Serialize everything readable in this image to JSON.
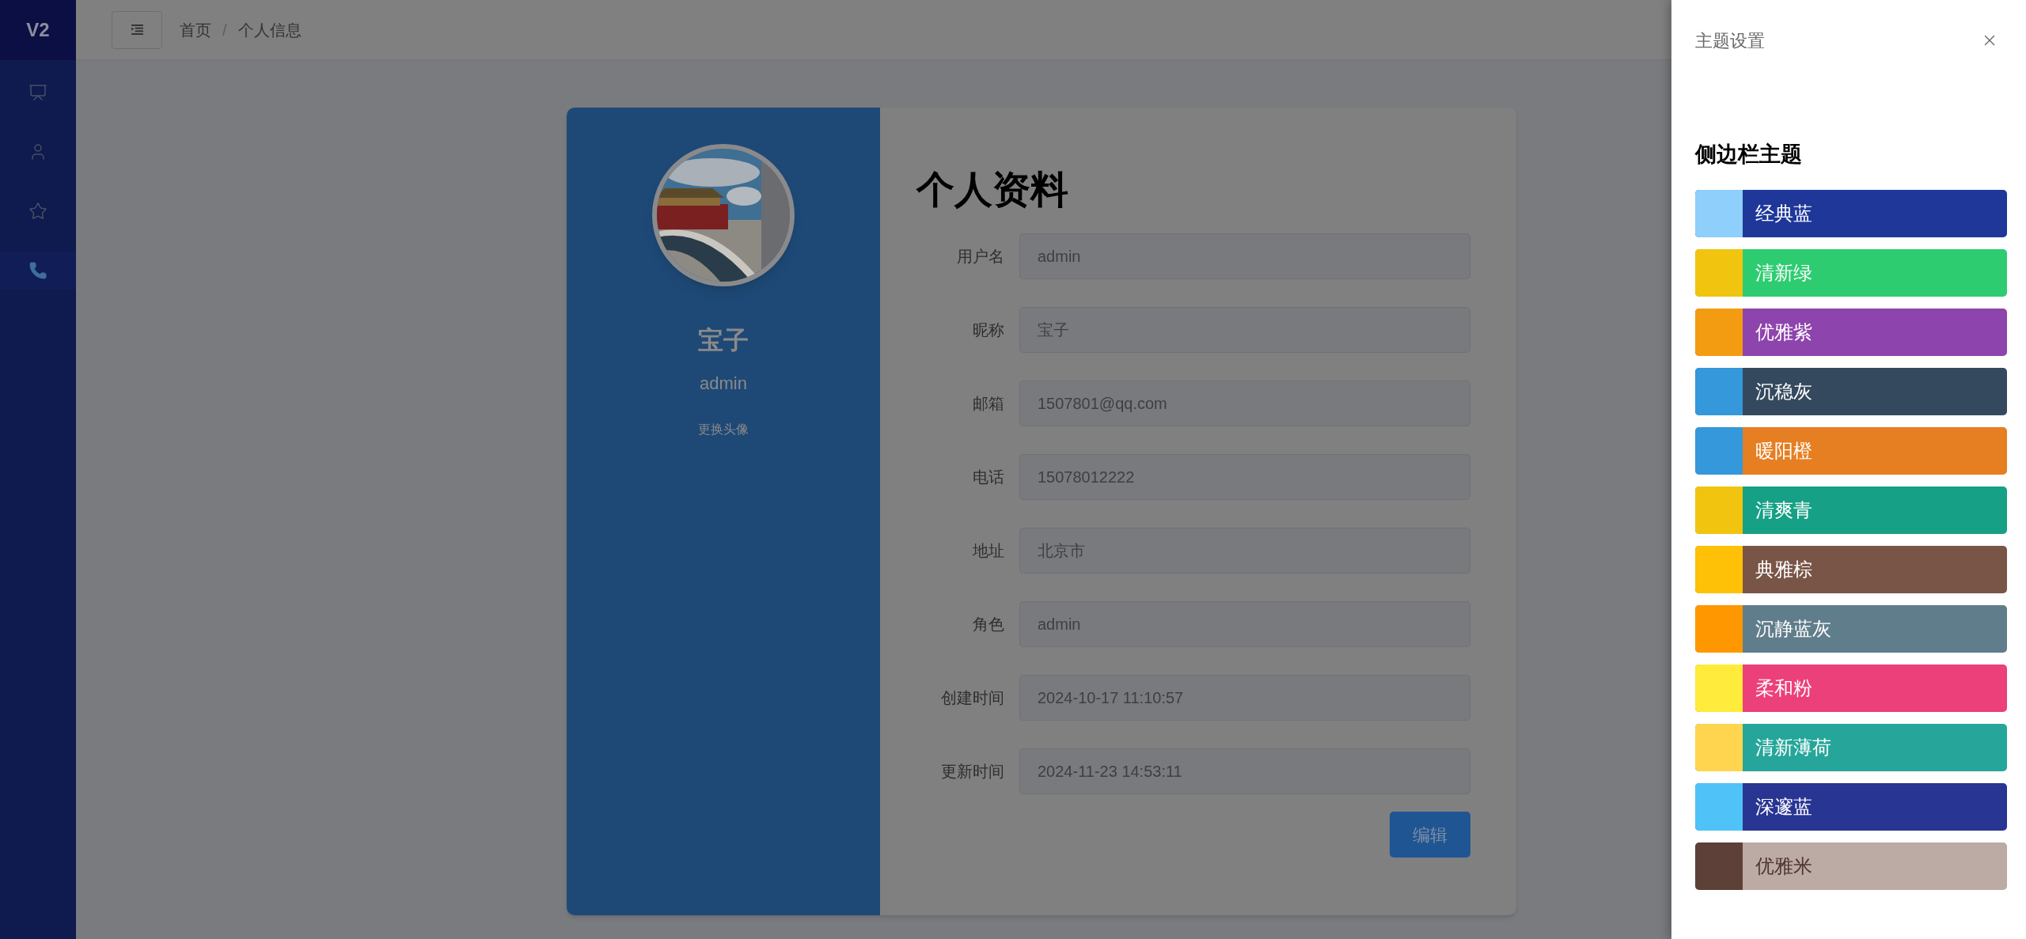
{
  "sidebar": {
    "logo": "V2",
    "items": [
      {
        "kind": "presentation",
        "selected": false
      },
      {
        "kind": "user",
        "selected": false
      },
      {
        "kind": "star",
        "selected": false
      },
      {
        "kind": "phone",
        "selected": true
      }
    ]
  },
  "header": {
    "breadcrumb": [
      "首页",
      "/",
      "个人信息"
    ]
  },
  "profile_card": {
    "name": "宝子",
    "username": "admin",
    "change_avatar": "更换头像",
    "title": "个人资料",
    "fields": [
      {
        "label": "用户名",
        "value": "admin"
      },
      {
        "label": "昵称",
        "value": "宝子"
      },
      {
        "label": "邮箱",
        "value": "1507801@qq.com"
      },
      {
        "label": "电话",
        "value": "15078012222"
      },
      {
        "label": "地址",
        "value": "北京市"
      },
      {
        "label": "角色",
        "value": "admin"
      },
      {
        "label": "创建时间",
        "value": "2024-10-17 11:10:57"
      },
      {
        "label": "更新时间",
        "value": "2024-11-23 14:53:11"
      }
    ],
    "edit_button": "编辑"
  },
  "drawer": {
    "title": "主题设置",
    "section_title": "侧边栏主题",
    "themes": [
      {
        "name": "经典蓝",
        "kind": "dark",
        "color": "#1e3799",
        "swatch": {
          "color": "#8fcffb"
        }
      },
      {
        "name": "清新绿",
        "kind": "dark",
        "color": "#2ecc71",
        "swatch": {
          "color": "#f1c40f"
        }
      },
      {
        "name": "优雅紫",
        "kind": "dark",
        "color": "#8e44ad",
        "swatch": {
          "color": "#f39c12"
        }
      },
      {
        "name": "沉稳灰",
        "kind": "dark",
        "color": "#34495e",
        "swatch": {
          "color": "#3498db"
        }
      },
      {
        "name": "暖阳橙",
        "kind": "dark",
        "color": "#e67e22",
        "swatch": {
          "color": "#3498db"
        }
      },
      {
        "name": "清爽青",
        "kind": "dark",
        "color": "#16a085",
        "swatch": {
          "color": "#f1c40f"
        }
      },
      {
        "name": "典雅棕",
        "kind": "dark",
        "color": "#795548",
        "swatch": {
          "color": "#ffc107"
        }
      },
      {
        "name": "沉静蓝灰",
        "kind": "dark",
        "color": "#607d8b",
        "swatch": {
          "color": "#ff9800"
        }
      },
      {
        "name": "柔和粉",
        "kind": "dark",
        "color": "#ec407a",
        "swatch": {
          "color": "#ffeb3b"
        }
      },
      {
        "name": "清新薄荷",
        "kind": "dark",
        "color": "#26a69a",
        "swatch": {
          "color": "#ffd54f"
        }
      },
      {
        "name": "深邃蓝",
        "kind": "dark",
        "color": "#283593",
        "swatch": {
          "color": "#4fc3f7"
        }
      },
      {
        "name": "优雅米",
        "kind": "light",
        "color": "#bcaaa4",
        "swatch": {
          "color": "#5d4037"
        }
      }
    ]
  }
}
